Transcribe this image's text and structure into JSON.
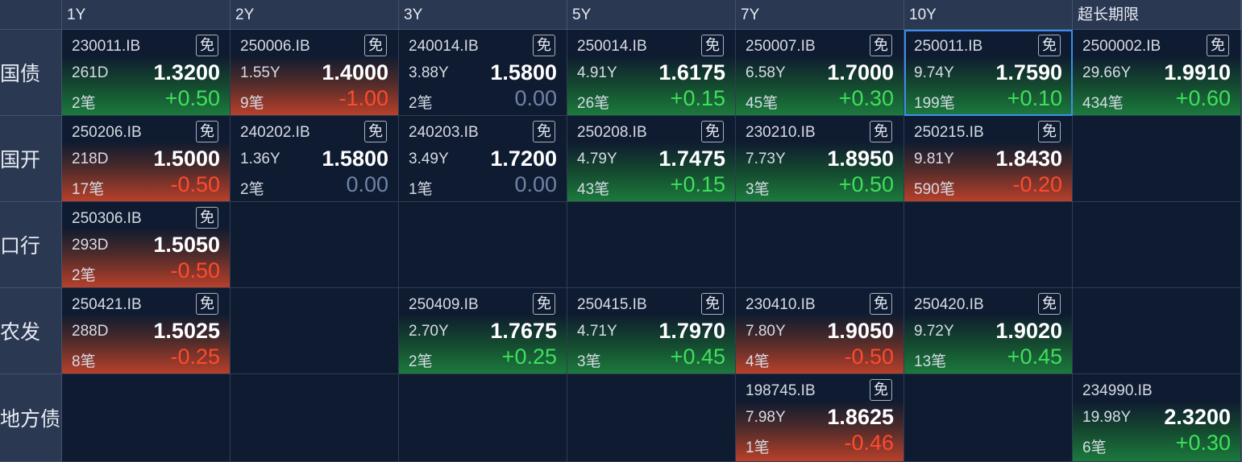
{
  "columns": [
    "1Y",
    "2Y",
    "3Y",
    "5Y",
    "7Y",
    "10Y",
    "超长期限"
  ],
  "rows": [
    {
      "label": "国债",
      "cells": [
        {
          "code": "230011.IB",
          "mian": "免",
          "term": "261D",
          "yield": "1.3200",
          "count": "2笔",
          "change": "+0.50",
          "trend": "up"
        },
        {
          "code": "250006.IB",
          "mian": "免",
          "term": "1.55Y",
          "yield": "1.4000",
          "count": "9笔",
          "change": "-1.00",
          "trend": "down"
        },
        {
          "code": "240014.IB",
          "mian": "免",
          "term": "3.88Y",
          "yield": "1.5800",
          "count": "2笔",
          "change": "0.00",
          "trend": "flat"
        },
        {
          "code": "250014.IB",
          "mian": "免",
          "term": "4.91Y",
          "yield": "1.6175",
          "count": "26笔",
          "change": "+0.15",
          "trend": "up"
        },
        {
          "code": "250007.IB",
          "mian": "免",
          "term": "6.58Y",
          "yield": "1.7000",
          "count": "45笔",
          "change": "+0.30",
          "trend": "up"
        },
        {
          "code": "250011.IB",
          "mian": "免",
          "term": "9.74Y",
          "yield": "1.7590",
          "count": "199笔",
          "change": "+0.10",
          "trend": "up",
          "selected": true
        },
        {
          "code": "2500002.IB",
          "mian": "免",
          "term": "29.66Y",
          "yield": "1.9910",
          "count": "434笔",
          "change": "+0.60",
          "trend": "up"
        }
      ]
    },
    {
      "label": "国开",
      "cells": [
        {
          "code": "250206.IB",
          "mian": "免",
          "term": "218D",
          "yield": "1.5000",
          "count": "17笔",
          "change": "-0.50",
          "trend": "down"
        },
        {
          "code": "240202.IB",
          "mian": "免",
          "term": "1.36Y",
          "yield": "1.5800",
          "count": "2笔",
          "change": "0.00",
          "trend": "flat"
        },
        {
          "code": "240203.IB",
          "mian": "免",
          "term": "3.49Y",
          "yield": "1.7200",
          "count": "1笔",
          "change": "0.00",
          "trend": "flat"
        },
        {
          "code": "250208.IB",
          "mian": "免",
          "term": "4.79Y",
          "yield": "1.7475",
          "count": "43笔",
          "change": "+0.15",
          "trend": "up"
        },
        {
          "code": "230210.IB",
          "mian": "免",
          "term": "7.73Y",
          "yield": "1.8950",
          "count": "3笔",
          "change": "+0.50",
          "trend": "up"
        },
        {
          "code": "250215.IB",
          "mian": "免",
          "term": "9.81Y",
          "yield": "1.8430",
          "count": "590笔",
          "change": "-0.20",
          "trend": "down"
        },
        null
      ]
    },
    {
      "label": "口行",
      "cells": [
        {
          "code": "250306.IB",
          "mian": "免",
          "term": "293D",
          "yield": "1.5050",
          "count": "2笔",
          "change": "-0.50",
          "trend": "down"
        },
        null,
        null,
        null,
        null,
        null,
        null
      ]
    },
    {
      "label": "农发",
      "cells": [
        {
          "code": "250421.IB",
          "mian": "免",
          "term": "288D",
          "yield": "1.5025",
          "count": "8笔",
          "change": "-0.25",
          "trend": "down"
        },
        null,
        {
          "code": "250409.IB",
          "mian": "免",
          "term": "2.70Y",
          "yield": "1.7675",
          "count": "2笔",
          "change": "+0.25",
          "trend": "up"
        },
        {
          "code": "250415.IB",
          "mian": "免",
          "term": "4.71Y",
          "yield": "1.7970",
          "count": "3笔",
          "change": "+0.45",
          "trend": "up"
        },
        {
          "code": "230410.IB",
          "mian": "免",
          "term": "7.80Y",
          "yield": "1.9050",
          "count": "4笔",
          "change": "-0.50",
          "trend": "down"
        },
        {
          "code": "250420.IB",
          "mian": "免",
          "term": "9.72Y",
          "yield": "1.9020",
          "count": "13笔",
          "change": "+0.45",
          "trend": "up"
        },
        null
      ]
    },
    {
      "label": "地方债",
      "cells": [
        null,
        null,
        null,
        null,
        {
          "code": "198745.IB",
          "mian": "免",
          "term": "7.98Y",
          "yield": "1.8625",
          "count": "1笔",
          "change": "-0.46",
          "trend": "down"
        },
        null,
        {
          "code": "234990.IB",
          "mian": "",
          "term": "19.98Y",
          "yield": "2.3200",
          "count": "6笔",
          "change": "+0.30",
          "trend": "up"
        }
      ]
    }
  ],
  "colors": {
    "background": "#0f1b30",
    "header": "#2b3852",
    "up": "#3ed85a",
    "down": "#ff4a2e",
    "flat": "#7083a8",
    "selection": "#3b8ef0"
  }
}
